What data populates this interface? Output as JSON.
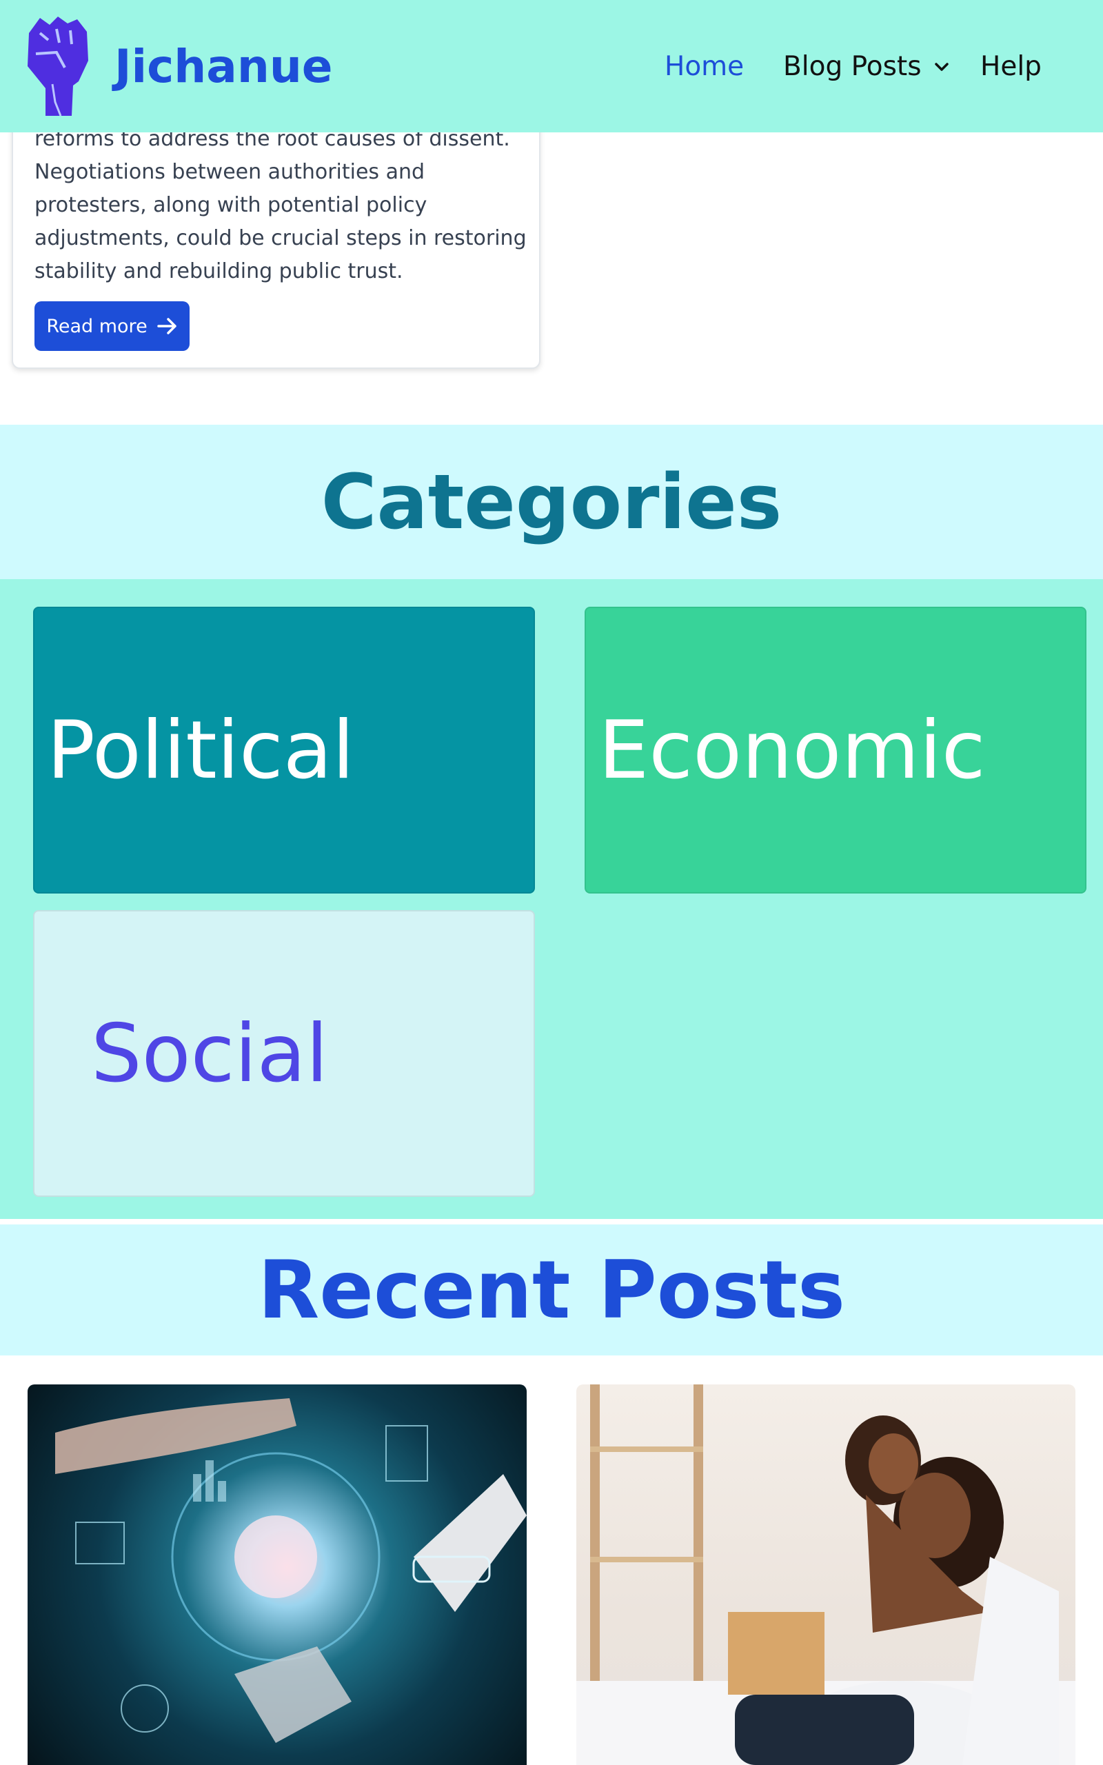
{
  "header": {
    "brand": "Jichanue",
    "nav": {
      "home": "Home",
      "blog_posts": "Blog Posts",
      "help": "Help"
    }
  },
  "previous_post": {
    "excerpt": "reforms to address the root causes of dissent. Negotiations between authorities and protesters, along with potential policy adjustments, could be crucial steps in restoring stability and rebuilding public trust.",
    "read_more": "Read more"
  },
  "categories": {
    "title": "Categories",
    "items": [
      "Political",
      "Economic",
      "Social"
    ]
  },
  "recent_posts": {
    "title": "Recent Posts"
  },
  "colors": {
    "header_bg": "#9cf6e5",
    "brand": "#1d4ed8",
    "political": "#0594a3",
    "economic": "#38d399",
    "social": "#d4f4f6"
  }
}
